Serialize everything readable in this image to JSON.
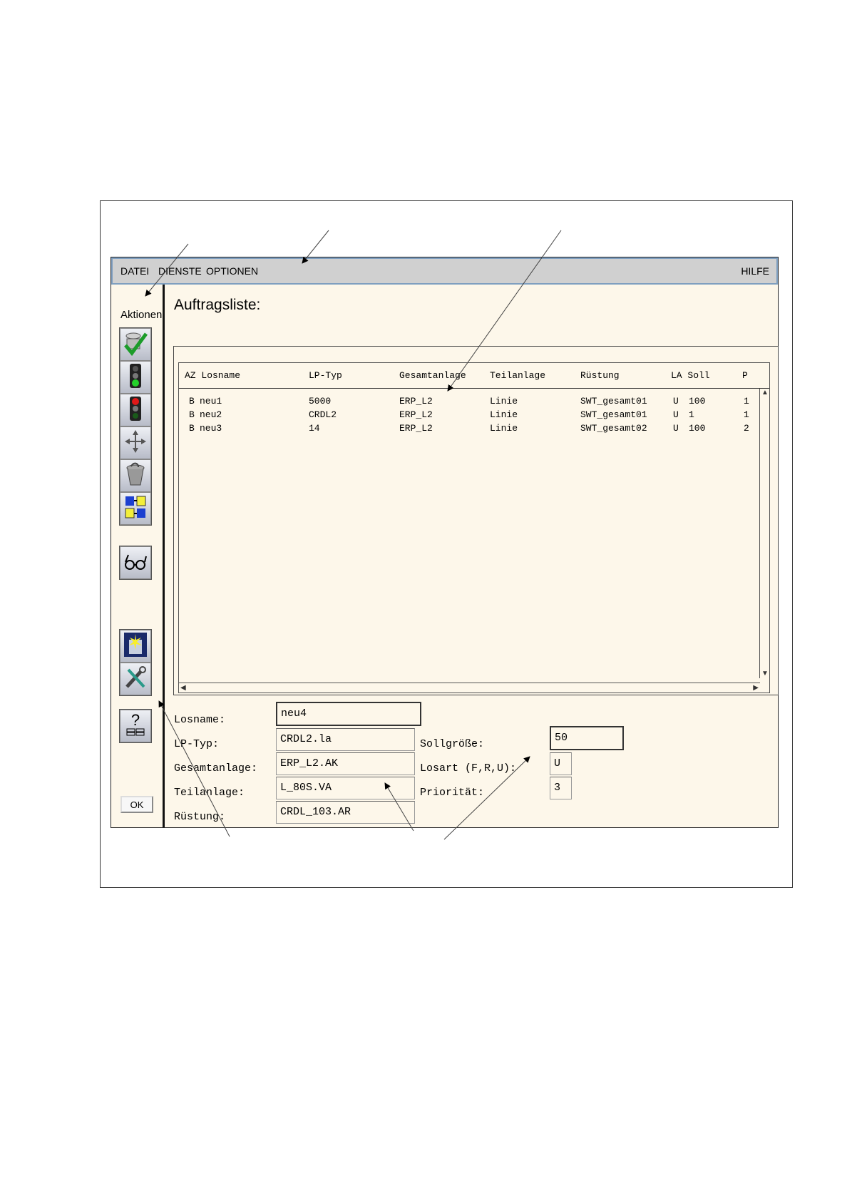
{
  "menu": {
    "datei": "DATEI",
    "dienste": "DIENSTE",
    "optionen": "OPTIONEN",
    "hilfe": "HILFE"
  },
  "sidebar": {
    "heading": "Aktionen",
    "icons": [
      "check-approve-icon",
      "traffic-light-green-icon",
      "traffic-light-red-icon",
      "move-arrows-icon",
      "trash-bin-icon",
      "swap-panels-icon",
      "glasses-icon",
      "new-document-icon",
      "tools-icon",
      "help-icon"
    ],
    "ok_label": "OK"
  },
  "title": "Auftragsliste:",
  "table": {
    "columns": [
      "AZ Losname",
      "LP-Typ",
      "Gesamtanlage",
      "Teilanlage",
      "Rüstung",
      "LA Soll",
      "P"
    ],
    "rows": [
      {
        "az": "B",
        "losname": "neu1",
        "lp_typ": "5000",
        "gesamtanlage": "ERP_L2",
        "teilanlage": "Linie",
        "ruestung": "SWT_gesamt01",
        "la": "U",
        "soll": "100",
        "p": "1"
      },
      {
        "az": "B",
        "losname": "neu2",
        "lp_typ": "CRDL2",
        "gesamtanlage": "ERP_L2",
        "teilanlage": "Linie",
        "ruestung": "SWT_gesamt01",
        "la": "U",
        "soll": "1",
        "p": "1"
      },
      {
        "az": "B",
        "losname": "neu3",
        "lp_typ": "14",
        "gesamtanlage": "ERP_L2",
        "teilanlage": "Linie",
        "ruestung": "SWT_gesamt02",
        "la": "U",
        "soll": "100",
        "p": "2"
      }
    ]
  },
  "form": {
    "losname": {
      "label": "Losname:",
      "value": "neu4"
    },
    "lp_typ": {
      "label": "LP-Typ:",
      "value": "CRDL2.la"
    },
    "gesamtanlage": {
      "label": "Gesamtanlage:",
      "value": "ERP_L2.AK"
    },
    "teilanlage": {
      "label": "Teilanlage:",
      "value": "L_80S.VA"
    },
    "ruestung": {
      "label": "Rüstung:",
      "value": "CRDL_103.AR"
    },
    "sollgroesse": {
      "label": "Sollgröße:",
      "value": "50"
    },
    "losart": {
      "label": "Losart (F,R,U):",
      "value": "U"
    },
    "prioritaet": {
      "label": "Priorität:",
      "value": "3"
    }
  }
}
